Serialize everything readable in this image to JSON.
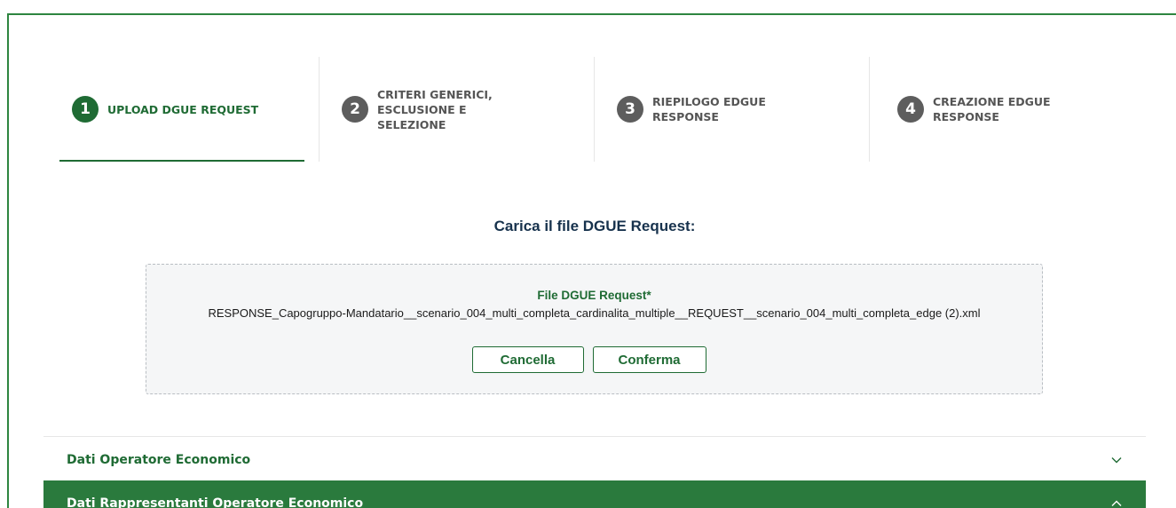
{
  "stepper": {
    "steps": [
      {
        "number": "1",
        "label": "UPLOAD DGUE REQUEST",
        "active": true
      },
      {
        "number": "2",
        "label": "CRITERI GENERICI,\nESCLUSIONE E\nSELEZIONE",
        "active": false
      },
      {
        "number": "3",
        "label": "RIEPILOGO EDGUE\nRESPONSE",
        "active": false
      },
      {
        "number": "4",
        "label": "CREAZIONE EDGUE\nRESPONSE",
        "active": false
      }
    ]
  },
  "upload": {
    "title": "Carica il file DGUE Request:",
    "file_label": "File DGUE Request*",
    "file_name": "RESPONSE_Capogruppo-Mandatario__scenario_004_multi_completa_cardinalita_multiple__REQUEST__scenario_004_multi_completa_edge (2).xml",
    "cancel_label": "Cancella",
    "confirm_label": "Conferma"
  },
  "accordions": [
    {
      "label": "Dati Operatore Economico",
      "expanded": false,
      "icon": "chevron-down-icon"
    },
    {
      "label": "Dati Rappresentanti Operatore Economico",
      "expanded": true,
      "icon": "chevron-up-icon"
    }
  ],
  "colors": {
    "primary_green": "#1f6b34",
    "accordion_green": "#2a7a3d",
    "inactive_step": "#5d5d5d",
    "title_navy": "#17324d"
  }
}
